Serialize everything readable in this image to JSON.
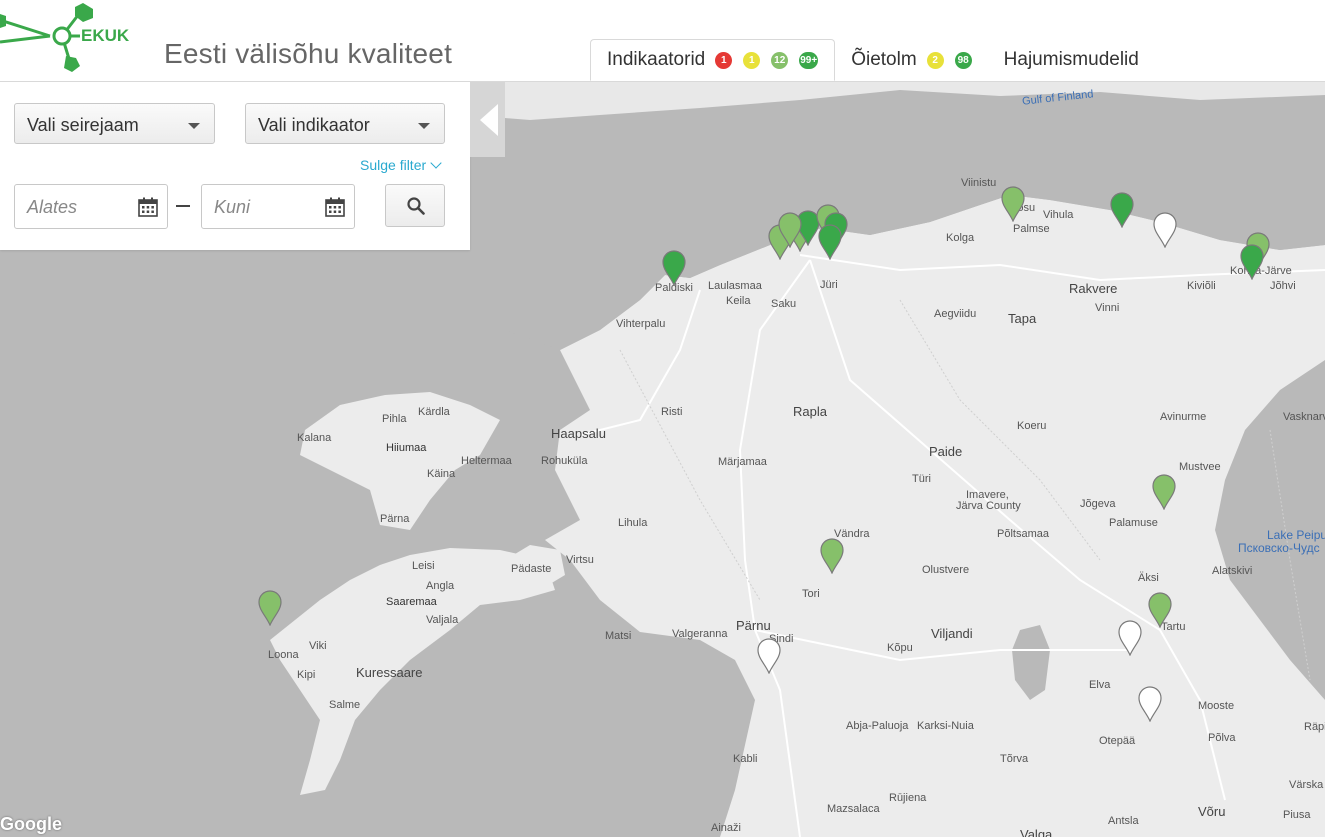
{
  "header": {
    "logo_text": "EKUK",
    "title": "Eesti välisõhu kvaliteet"
  },
  "tabs": [
    {
      "label": "Indikaatorid",
      "badges": [
        "1",
        "1",
        "12",
        "99+"
      ]
    },
    {
      "label": "Õietolm",
      "badges": [
        "2",
        "98"
      ]
    },
    {
      "label": "Hajumismudelid"
    }
  ],
  "filter": {
    "station_select": "Vali seirejaam",
    "indicator_select": "Vali indikaator",
    "close_filter": "Sulge filter",
    "from_placeholder": "Alates",
    "to_placeholder": "Kuni"
  },
  "colors": {
    "brand_green": "#3aa84a",
    "light_green": "#86c06a",
    "red": "#e53935",
    "yellow": "#e8e13a",
    "link_blue": "#29a9cf"
  },
  "map": {
    "attribution": "Google",
    "labels": {
      "gulf": "Gulf of Finland",
      "lake": "Lake Peipus",
      "lake_ru": "Псковско-Чудс",
      "viinistu": "Viinistu",
      "vosu": "Võsu",
      "vihula": "Vihula",
      "kolga": "Kolga",
      "palmse": "Palmse",
      "paldiski": "Paldiski",
      "laulasmaa": "Laulasmaa",
      "keila": "Keila",
      "saku": "Saku",
      "juri": "Jüri",
      "vihterpalu": "Vihterpalu",
      "aegviidu": "Aegviidu",
      "tapa": "Tapa",
      "rakvere": "Rakvere",
      "vinni": "Vinni",
      "kivioli": "Kiviõli",
      "kohtla": "Kohtla-Järve",
      "johvi": "Jõhvi",
      "pihla": "Pihla",
      "kardla": "Kärdla",
      "kalana": "Kalana",
      "hiiumaa": "Hiiumaa",
      "heltermaa": "Heltermaa",
      "kaina": "Käina",
      "parna": "Pärna",
      "haapsalu": "Haapsalu",
      "rohukula": "Rohuküla",
      "risti": "Risti",
      "rapla": "Rapla",
      "marjamaa": "Märjamaa",
      "paide": "Paide",
      "koeru": "Koeru",
      "avinurme": "Avinurme",
      "vasknarva": "Vasknarva",
      "turi": "Türi",
      "imavere": "Imavere,",
      "jarva": "Järva County",
      "mustvee": "Mustvee",
      "jogeva": "Jõgeva",
      "palamuse": "Palamuse",
      "lihula": "Lihula",
      "virtsu": "Virtsu",
      "padaste": "Pädaste",
      "vandra": "Vändra",
      "poltsamaa": "Põltsamaa",
      "alatskivi": "Alatskivi",
      "leisi": "Leisi",
      "angla": "Angla",
      "saaremaa": "Saaremaa",
      "valjala": "Valjala",
      "tori": "Tori",
      "olustvere": "Olustvere",
      "aksi": "Äksi",
      "matsi": "Matsi",
      "valgeranna": "Valgeranna",
      "parnu": "Pärnu",
      "sindi": "Sindi",
      "viljandi": "Viljandi",
      "tartu": "Tartu",
      "loona": "Loona",
      "viki": "Viki",
      "kuressaare": "Kuressaare",
      "kipi": "Kipi",
      "kopu": "Kõpu",
      "elva": "Elva",
      "salme": "Salme",
      "abja": "Abja-Paluoja",
      "karksi": "Karksi-Nuia",
      "mooste": "Mooste",
      "rapina": "Räpina",
      "otepaa": "Otepää",
      "polva": "Põlva",
      "kabli": "Kabli",
      "torva": "Tõrva",
      "rujiena": "Rūjiena",
      "mazsalaca": "Mazsalaca",
      "voru": "Võru",
      "ainazi": "Ainaži",
      "antsla": "Antsla",
      "valga": "Valga",
      "varska": "Värska",
      "piusa": "Piusa"
    }
  }
}
